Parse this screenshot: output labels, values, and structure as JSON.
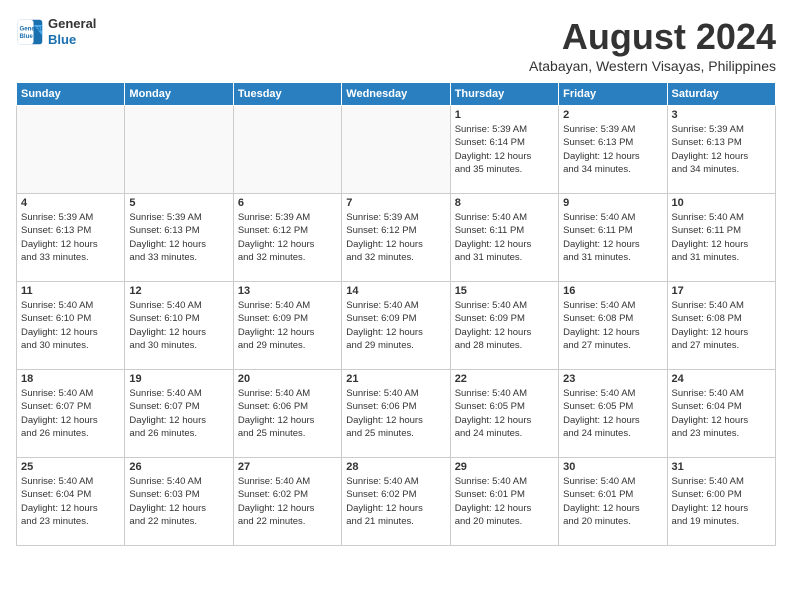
{
  "header": {
    "logo_line1": "General",
    "logo_line2": "Blue",
    "title": "August 2024",
    "subtitle": "Atabayan, Western Visayas, Philippines"
  },
  "weekdays": [
    "Sunday",
    "Monday",
    "Tuesday",
    "Wednesday",
    "Thursday",
    "Friday",
    "Saturday"
  ],
  "weeks": [
    [
      {
        "day": "",
        "info": ""
      },
      {
        "day": "",
        "info": ""
      },
      {
        "day": "",
        "info": ""
      },
      {
        "day": "",
        "info": ""
      },
      {
        "day": "1",
        "info": "Sunrise: 5:39 AM\nSunset: 6:14 PM\nDaylight: 12 hours\nand 35 minutes."
      },
      {
        "day": "2",
        "info": "Sunrise: 5:39 AM\nSunset: 6:13 PM\nDaylight: 12 hours\nand 34 minutes."
      },
      {
        "day": "3",
        "info": "Sunrise: 5:39 AM\nSunset: 6:13 PM\nDaylight: 12 hours\nand 34 minutes."
      }
    ],
    [
      {
        "day": "4",
        "info": "Sunrise: 5:39 AM\nSunset: 6:13 PM\nDaylight: 12 hours\nand 33 minutes."
      },
      {
        "day": "5",
        "info": "Sunrise: 5:39 AM\nSunset: 6:13 PM\nDaylight: 12 hours\nand 33 minutes."
      },
      {
        "day": "6",
        "info": "Sunrise: 5:39 AM\nSunset: 6:12 PM\nDaylight: 12 hours\nand 32 minutes."
      },
      {
        "day": "7",
        "info": "Sunrise: 5:39 AM\nSunset: 6:12 PM\nDaylight: 12 hours\nand 32 minutes."
      },
      {
        "day": "8",
        "info": "Sunrise: 5:40 AM\nSunset: 6:11 PM\nDaylight: 12 hours\nand 31 minutes."
      },
      {
        "day": "9",
        "info": "Sunrise: 5:40 AM\nSunset: 6:11 PM\nDaylight: 12 hours\nand 31 minutes."
      },
      {
        "day": "10",
        "info": "Sunrise: 5:40 AM\nSunset: 6:11 PM\nDaylight: 12 hours\nand 31 minutes."
      }
    ],
    [
      {
        "day": "11",
        "info": "Sunrise: 5:40 AM\nSunset: 6:10 PM\nDaylight: 12 hours\nand 30 minutes."
      },
      {
        "day": "12",
        "info": "Sunrise: 5:40 AM\nSunset: 6:10 PM\nDaylight: 12 hours\nand 30 minutes."
      },
      {
        "day": "13",
        "info": "Sunrise: 5:40 AM\nSunset: 6:09 PM\nDaylight: 12 hours\nand 29 minutes."
      },
      {
        "day": "14",
        "info": "Sunrise: 5:40 AM\nSunset: 6:09 PM\nDaylight: 12 hours\nand 29 minutes."
      },
      {
        "day": "15",
        "info": "Sunrise: 5:40 AM\nSunset: 6:09 PM\nDaylight: 12 hours\nand 28 minutes."
      },
      {
        "day": "16",
        "info": "Sunrise: 5:40 AM\nSunset: 6:08 PM\nDaylight: 12 hours\nand 27 minutes."
      },
      {
        "day": "17",
        "info": "Sunrise: 5:40 AM\nSunset: 6:08 PM\nDaylight: 12 hours\nand 27 minutes."
      }
    ],
    [
      {
        "day": "18",
        "info": "Sunrise: 5:40 AM\nSunset: 6:07 PM\nDaylight: 12 hours\nand 26 minutes."
      },
      {
        "day": "19",
        "info": "Sunrise: 5:40 AM\nSunset: 6:07 PM\nDaylight: 12 hours\nand 26 minutes."
      },
      {
        "day": "20",
        "info": "Sunrise: 5:40 AM\nSunset: 6:06 PM\nDaylight: 12 hours\nand 25 minutes."
      },
      {
        "day": "21",
        "info": "Sunrise: 5:40 AM\nSunset: 6:06 PM\nDaylight: 12 hours\nand 25 minutes."
      },
      {
        "day": "22",
        "info": "Sunrise: 5:40 AM\nSunset: 6:05 PM\nDaylight: 12 hours\nand 24 minutes."
      },
      {
        "day": "23",
        "info": "Sunrise: 5:40 AM\nSunset: 6:05 PM\nDaylight: 12 hours\nand 24 minutes."
      },
      {
        "day": "24",
        "info": "Sunrise: 5:40 AM\nSunset: 6:04 PM\nDaylight: 12 hours\nand 23 minutes."
      }
    ],
    [
      {
        "day": "25",
        "info": "Sunrise: 5:40 AM\nSunset: 6:04 PM\nDaylight: 12 hours\nand 23 minutes."
      },
      {
        "day": "26",
        "info": "Sunrise: 5:40 AM\nSunset: 6:03 PM\nDaylight: 12 hours\nand 22 minutes."
      },
      {
        "day": "27",
        "info": "Sunrise: 5:40 AM\nSunset: 6:02 PM\nDaylight: 12 hours\nand 22 minutes."
      },
      {
        "day": "28",
        "info": "Sunrise: 5:40 AM\nSunset: 6:02 PM\nDaylight: 12 hours\nand 21 minutes."
      },
      {
        "day": "29",
        "info": "Sunrise: 5:40 AM\nSunset: 6:01 PM\nDaylight: 12 hours\nand 20 minutes."
      },
      {
        "day": "30",
        "info": "Sunrise: 5:40 AM\nSunset: 6:01 PM\nDaylight: 12 hours\nand 20 minutes."
      },
      {
        "day": "31",
        "info": "Sunrise: 5:40 AM\nSunset: 6:00 PM\nDaylight: 12 hours\nand 19 minutes."
      }
    ]
  ]
}
